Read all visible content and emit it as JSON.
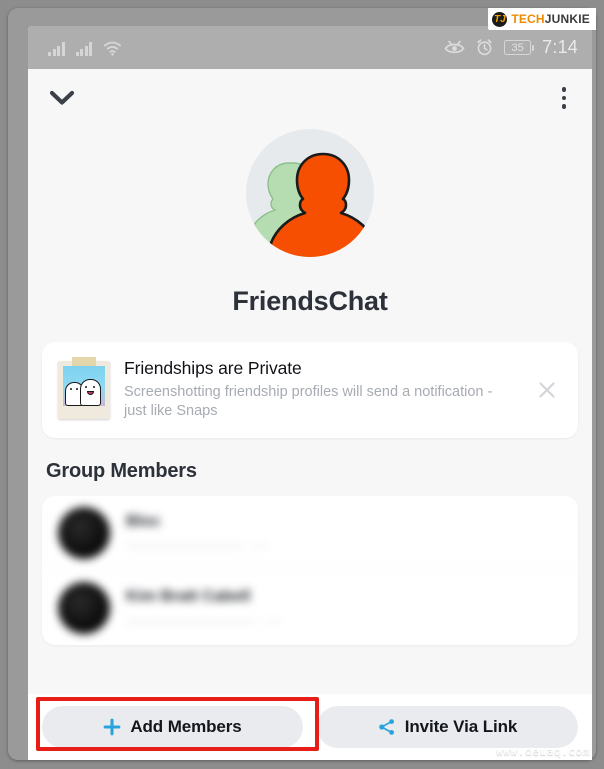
{
  "watermarks": {
    "brand_mark": "TJ",
    "brand_name_a": "TECH",
    "brand_name_b": "JUNKIE",
    "site_url": "www.deuaq.com"
  },
  "status_bar": {
    "signal_1": "signal-bars-icon",
    "signal_2": "signal-bars-icon",
    "wifi": "wifi-icon",
    "eye": "eye-icon",
    "alarm": "alarm-clock-icon",
    "battery_level": "35",
    "time": "7:14"
  },
  "top_nav": {
    "back_icon": "chevron-down-icon",
    "menu_icon": "kebab-menu-icon"
  },
  "profile": {
    "avatar_icon": "group-avatar-icon",
    "title": "FriendsChat"
  },
  "notice": {
    "icon": "polaroid-ghosts-icon",
    "title": "Friendships are Private",
    "body": "Screenshotting friendship profiles will send a notification - just like Snaps",
    "close_icon": "close-icon"
  },
  "members_section": {
    "heading": "Group Members",
    "rows": [
      {
        "name": "Bloc",
        "handle": "blurred-handle-1"
      },
      {
        "name": "Kim Bratt Cabell",
        "handle": "blurred-handle-2"
      }
    ]
  },
  "actions": {
    "add_members": {
      "icon": "plus-icon",
      "label": "Add Members"
    },
    "invite_via_link": {
      "icon": "share-icon",
      "label": "Invite Via Link"
    },
    "highlight_color": "#e71d17",
    "accent_color": "#2aa3dd"
  }
}
